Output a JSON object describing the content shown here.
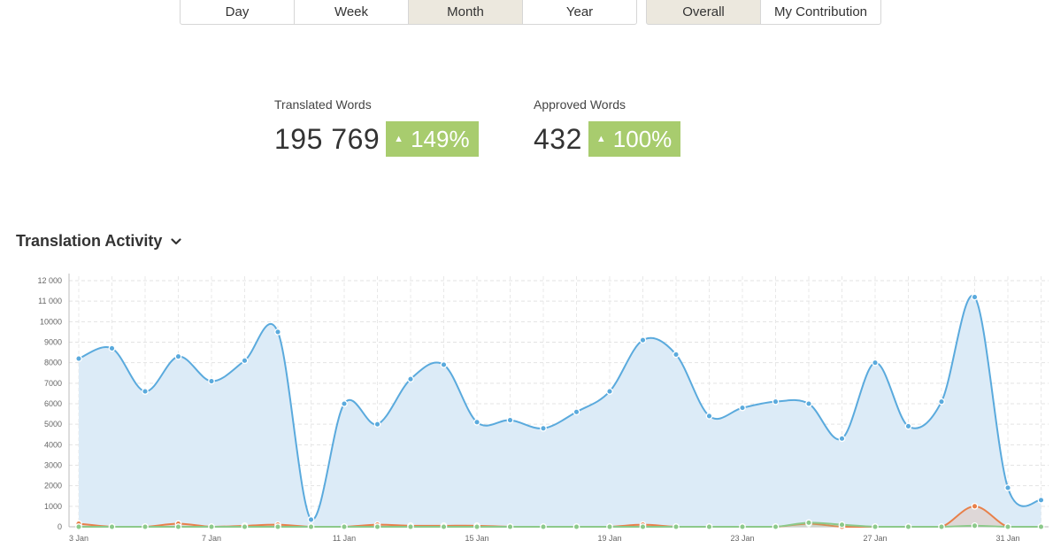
{
  "period_buttons": [
    "Day",
    "Week",
    "Month",
    "Year"
  ],
  "period_selected": "Month",
  "scope_buttons": [
    "Overall",
    "My Contribution"
  ],
  "scope_selected": "Overall",
  "stats": {
    "translated": {
      "label": "Translated Words",
      "value": "195 769",
      "change": "149%"
    },
    "approved": {
      "label": "Approved Words",
      "value": "432",
      "change": "100%"
    }
  },
  "section_title": "Translation Activity",
  "icons": {
    "dropdown": "chevron-down-icon",
    "up": "triangle-up-icon"
  },
  "colors": {
    "blue_series": "#5aaadd",
    "blue_fill": "#dcebf7",
    "orange_series": "#e8804a",
    "green_series": "#8cc98a",
    "badge": "#a8cc6e",
    "active_button": "#ece8de"
  },
  "chart_data": {
    "type": "area",
    "x": [
      "3 Jan",
      "4 Jan",
      "5 Jan",
      "6 Jan",
      "7 Jan",
      "8 Jan",
      "9 Jan",
      "10 Jan",
      "11 Jan",
      "12 Jan",
      "13 Jan",
      "14 Jan",
      "15 Jan",
      "16 Jan",
      "17 Jan",
      "18 Jan",
      "19 Jan",
      "20 Jan",
      "21 Jan",
      "22 Jan",
      "23 Jan",
      "24 Jan",
      "25 Jan",
      "26 Jan",
      "27 Jan",
      "28 Jan",
      "29 Jan",
      "30 Jan",
      "31 Jan",
      "1 Feb"
    ],
    "x_tick_labels": [
      "3 Jan",
      "7 Jan",
      "11 Jan",
      "15 Jan",
      "19 Jan",
      "23 Jan",
      "27 Jan",
      "31 Jan"
    ],
    "y_tick_labels": [
      "0",
      "1000",
      "2000",
      "3000",
      "4000",
      "5000",
      "6000",
      "7000",
      "8000",
      "9000",
      "10000",
      "11 000",
      "12 000"
    ],
    "ylim": [
      0,
      12000
    ],
    "grid": true,
    "series": [
      {
        "color": "#5aaadd",
        "values": [
          8200,
          8700,
          6600,
          8300,
          7100,
          8100,
          9500,
          350,
          6000,
          5000,
          7200,
          7900,
          5100,
          5200,
          4800,
          5600,
          6600,
          9100,
          8400,
          5400,
          5800,
          6100,
          6000,
          4300,
          8000,
          4900,
          6100,
          11200,
          1900,
          1300
        ]
      },
      {
        "color": "#e8804a",
        "values": [
          150,
          0,
          0,
          150,
          0,
          50,
          100,
          0,
          0,
          100,
          50,
          50,
          50,
          0,
          0,
          0,
          0,
          100,
          0,
          0,
          0,
          0,
          150,
          0,
          0,
          0,
          0,
          1000,
          0,
          0
        ]
      },
      {
        "color": "#8cc98a",
        "values": [
          0,
          0,
          0,
          0,
          0,
          0,
          0,
          0,
          0,
          0,
          0,
          0,
          0,
          0,
          0,
          0,
          0,
          0,
          0,
          0,
          0,
          0,
          200,
          100,
          0,
          0,
          0,
          50,
          0,
          0
        ]
      }
    ]
  }
}
